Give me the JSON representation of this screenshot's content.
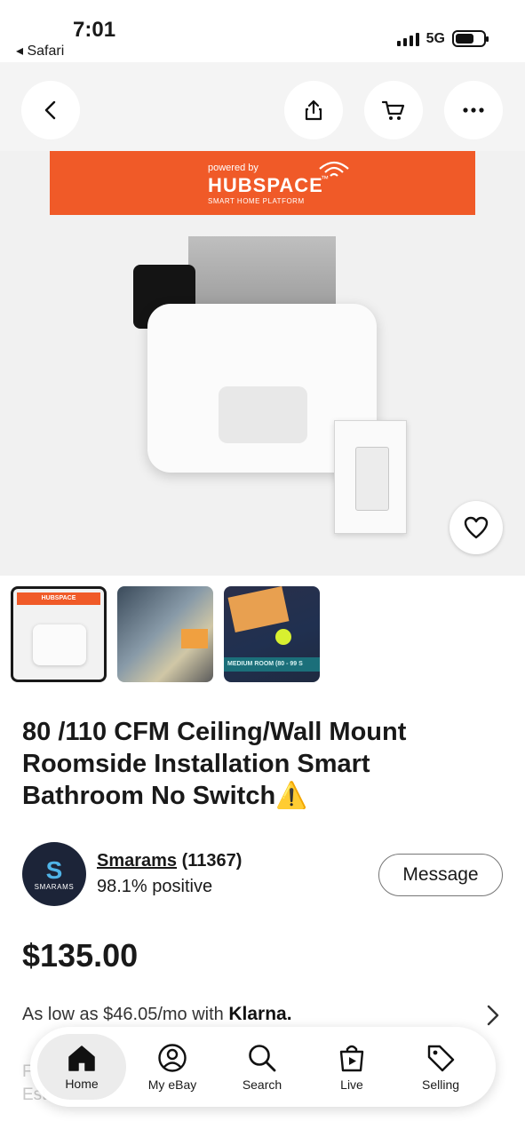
{
  "status_bar": {
    "time": "7:01",
    "back_app": "◂ Safari",
    "network": "5G"
  },
  "top_nav": {
    "back_icon": "chevron-left-icon",
    "share_icon": "share-icon",
    "cart_icon": "cart-icon",
    "more_icon": "more-horizontal-icon"
  },
  "hero": {
    "banner_powered": "powered by",
    "banner_brand": "HUBSPACE",
    "banner_tm": "™",
    "banner_sub": "SMART HOME PLATFORM",
    "favorite_icon": "heart-icon",
    "brand_color": "#f05a28"
  },
  "thumbnails": [
    {
      "label": "HUBSPACE"
    },
    {
      "label": ""
    },
    {
      "label": "MEDIUM ROOM (80 - 99 S"
    }
  ],
  "listing": {
    "title": "80 /110 CFM Ceiling/Wall Mount Roomside Installation Smart Bathroom No Switch⚠️",
    "price": "$135.00"
  },
  "seller": {
    "avatar_initial": "S",
    "avatar_text": "SMARAMS",
    "name": "Smarams",
    "feedback": "(11367)",
    "positive": "98.1% positive",
    "message_label": "Message"
  },
  "financing": {
    "prefix": "As low as $46.05/mo with",
    "provider": "Klarna."
  },
  "partially_hidden": {
    "line1": "F",
    "line2": "Est"
  },
  "tabbar": [
    {
      "label": "Home",
      "icon": "home-icon",
      "active": true
    },
    {
      "label": "My eBay",
      "icon": "user-circle-icon",
      "active": false
    },
    {
      "label": "Search",
      "icon": "search-icon",
      "active": false
    },
    {
      "label": "Live",
      "icon": "live-bag-icon",
      "active": false
    },
    {
      "label": "Selling",
      "icon": "tag-icon",
      "active": false
    }
  ]
}
